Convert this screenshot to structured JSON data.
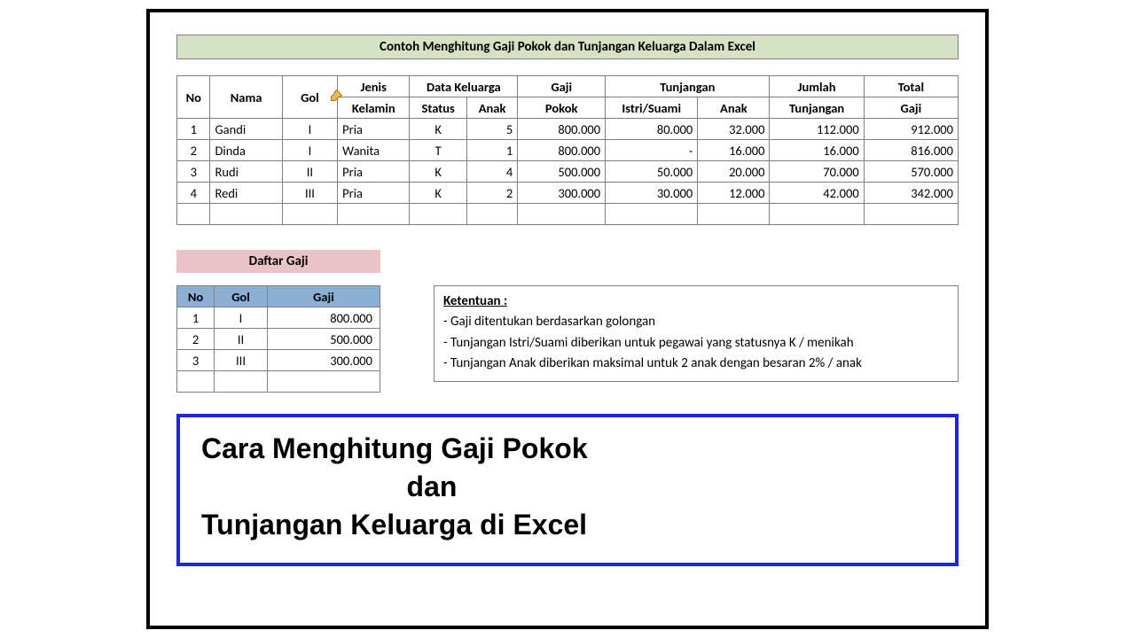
{
  "title": "Contoh Menghitung Gaji Pokok dan Tunjangan Keluarga Dalam Excel",
  "main_table": {
    "head_top": {
      "no": "No",
      "nama": "Nama",
      "gol": "Gol",
      "jenis": "Jenis",
      "data_keluarga": "Data Keluarga",
      "gaji": "Gaji",
      "tunjangan": "Tunjangan",
      "jumlah": "Jumlah",
      "total": "Total"
    },
    "head_bot": {
      "kelamin": "Kelamin",
      "status": "Status",
      "anak_k": "Anak",
      "pokok": "Pokok",
      "istri": "Istri/Suami",
      "anak_t": "Anak",
      "tunjangan": "Tunjangan",
      "gaji": "Gaji"
    },
    "rows": [
      {
        "no": "1",
        "nama": "Gandi",
        "gol": "I",
        "jk": "Pria",
        "status": "K",
        "anak": "5",
        "pokok": "800.000",
        "istri": "80.000",
        "tanak": "32.000",
        "jml": "112.000",
        "total": "912.000"
      },
      {
        "no": "2",
        "nama": "Dinda",
        "gol": "I",
        "jk": "Wanita",
        "status": "T",
        "anak": "1",
        "pokok": "800.000",
        "istri": "-",
        "tanak": "16.000",
        "jml": "16.000",
        "total": "816.000"
      },
      {
        "no": "3",
        "nama": "Rudi",
        "gol": "II",
        "jk": "Pria",
        "status": "K",
        "anak": "4",
        "pokok": "500.000",
        "istri": "50.000",
        "tanak": "20.000",
        "jml": "70.000",
        "total": "570.000"
      },
      {
        "no": "4",
        "nama": "Redi",
        "gol": "III",
        "jk": "Pria",
        "status": "K",
        "anak": "2",
        "pokok": "300.000",
        "istri": "30.000",
        "tanak": "12.000",
        "jml": "42.000",
        "total": "342.000"
      }
    ]
  },
  "gaji_title": "Daftar Gaji",
  "gaji_table": {
    "head": {
      "no": "No",
      "gol": "Gol",
      "gaji": "Gaji"
    },
    "rows": [
      {
        "no": "1",
        "gol": "I",
        "gaji": "800.000"
      },
      {
        "no": "2",
        "gol": "II",
        "gaji": "500.000"
      },
      {
        "no": "3",
        "gol": "III",
        "gaji": "300.000"
      }
    ]
  },
  "rules": {
    "heading": "Ketentuan :",
    "l1": "- Gaji ditentukan berdasarkan golongan",
    "l2": "- Tunjangan Istri/Suami diberikan untuk pegawai yang statusnya K / menikah",
    "l3": "- Tunjangan Anak diberikan maksimal untuk 2 anak dengan besaran 2% / anak"
  },
  "banner": {
    "l1": "Cara Menghitung Gaji Pokok",
    "l2": "dan",
    "l3": "Tunjangan Keluarga di Excel"
  },
  "chart_data": {
    "type": "table",
    "title": "Contoh Menghitung Gaji Pokok dan Tunjangan Keluarga Dalam Excel",
    "columns": [
      "No",
      "Nama",
      "Gol",
      "Jenis Kelamin",
      "Status",
      "Anak",
      "Gaji Pokok",
      "Tunj Istri/Suami",
      "Tunj Anak",
      "Jumlah Tunjangan",
      "Total Gaji"
    ],
    "rows": [
      [
        1,
        "Gandi",
        "I",
        "Pria",
        "K",
        5,
        800000,
        80000,
        32000,
        112000,
        912000
      ],
      [
        2,
        "Dinda",
        "I",
        "Wanita",
        "T",
        1,
        800000,
        0,
        16000,
        16000,
        816000
      ],
      [
        3,
        "Rudi",
        "II",
        "Pria",
        "K",
        4,
        500000,
        50000,
        20000,
        70000,
        570000
      ],
      [
        4,
        "Redi",
        "III",
        "Pria",
        "K",
        2,
        300000,
        30000,
        12000,
        42000,
        342000
      ]
    ],
    "lookup_table": {
      "columns": [
        "No",
        "Gol",
        "Gaji"
      ],
      "rows": [
        [
          1,
          "I",
          800000
        ],
        [
          2,
          "II",
          500000
        ],
        [
          3,
          "III",
          300000
        ]
      ]
    }
  }
}
